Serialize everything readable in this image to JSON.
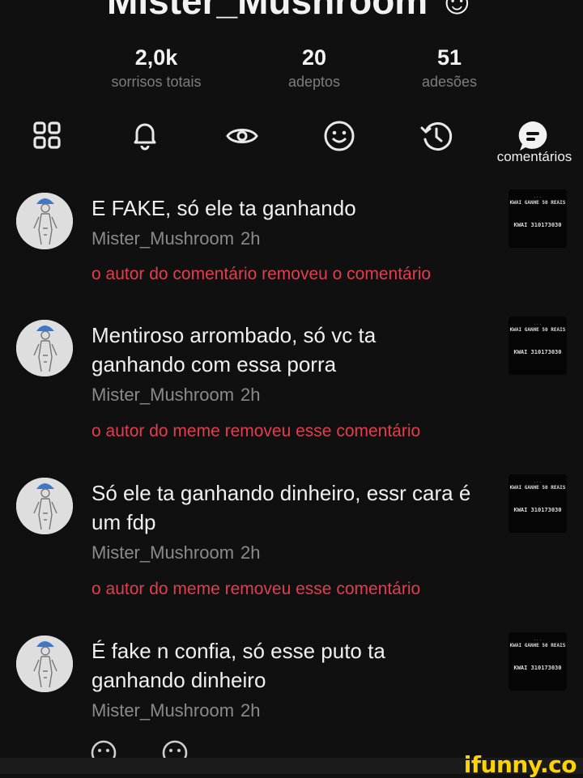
{
  "header": {
    "title": "Mister_Mushroom ☺"
  },
  "stats": [
    {
      "value": "2,0k",
      "label": "sorrisos totais"
    },
    {
      "value": "20",
      "label": "adeptos"
    },
    {
      "value": "51",
      "label": "adesões"
    }
  ],
  "tabs": {
    "active_label": "comentários",
    "icons": [
      "grid-icon",
      "bell-icon",
      "eye-icon",
      "smiley-icon",
      "history-icon",
      "comments-icon"
    ]
  },
  "comments": [
    {
      "text": "E FAKE, só ele ta ganhando",
      "author": "Mister_Mushroom",
      "time": "2h",
      "removed": "o autor do comentário removeu o comentário"
    },
    {
      "text": "Mentiroso arrombado, só vc ta ganhando com essa porra",
      "author": "Mister_Mushroom",
      "time": "2h",
      "removed": "o autor do meme removeu esse comentário"
    },
    {
      "text": "Só ele ta ganhando dinheiro, essr cara é um fdp",
      "author": "Mister_Mushroom",
      "time": "2h",
      "removed": "o autor do meme removeu esse comentário"
    },
    {
      "text": "É fake n confia, só esse puto ta ganhando dinheiro",
      "author": "Mister_Mushroom",
      "time": "2h",
      "removed": ""
    }
  ],
  "thumbnail": {
    "line1": "...",
    "line2": "KWAI GANHE 50 REAIS",
    "line3": "KWAI 310173030"
  },
  "watermark": "ifunny.co",
  "colors": {
    "background": "#111010",
    "removed_text": "#e23d4f",
    "watermark": "#ffd200"
  }
}
